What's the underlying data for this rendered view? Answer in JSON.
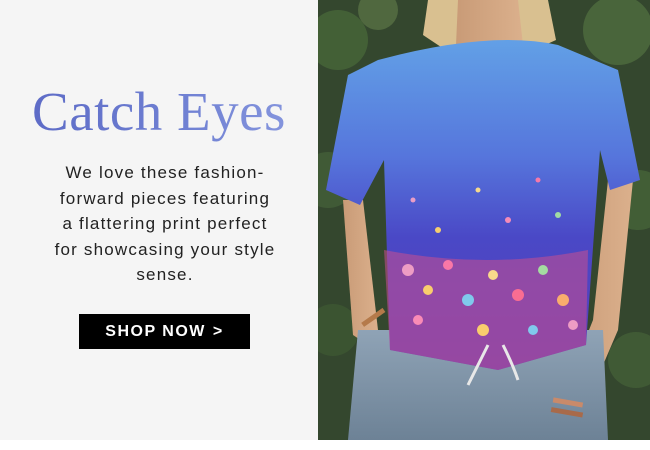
{
  "promo": {
    "headline": "Catch Eyes",
    "body_text": "We love these fashion-forward pieces featuring a flattering print perfect for showcasing your style sense.",
    "button_label": "SHOP NOW",
    "button_chevron": ">"
  },
  "colors": {
    "headline_gradient_start": "#5a67c4",
    "headline_gradient_end": "#8a9ae0",
    "panel_background": "#f5f5f5",
    "button_background": "#000000",
    "button_text": "#ffffff",
    "shirt_top": "#5d8fe0",
    "shirt_mid": "#4b53c9",
    "foliage": "#3c5232"
  },
  "icons": [
    "chevron-right-icon"
  ]
}
